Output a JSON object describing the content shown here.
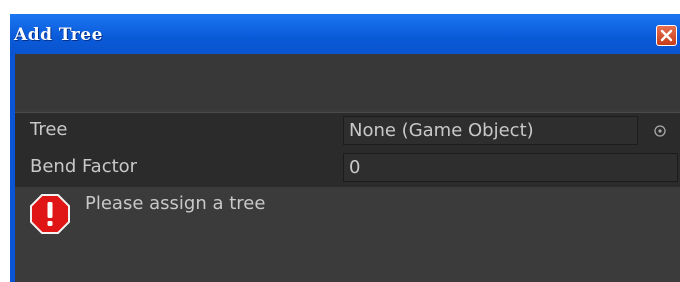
{
  "window": {
    "title": "Add Tree"
  },
  "fields": {
    "tree": {
      "label": "Tree",
      "value": "None (Game Object)"
    },
    "bend_factor": {
      "label": "Bend Factor",
      "value": "0"
    }
  },
  "help_box": {
    "message": "Please assign a tree",
    "icon": "error-icon"
  },
  "icons": {
    "close": "close-icon",
    "object_picker": "object-picker-icon"
  },
  "colors": {
    "titlebar": "#0a5ad8",
    "close_button": "#d04a24",
    "panel": "#3b3b3b",
    "error": "#e01515"
  }
}
